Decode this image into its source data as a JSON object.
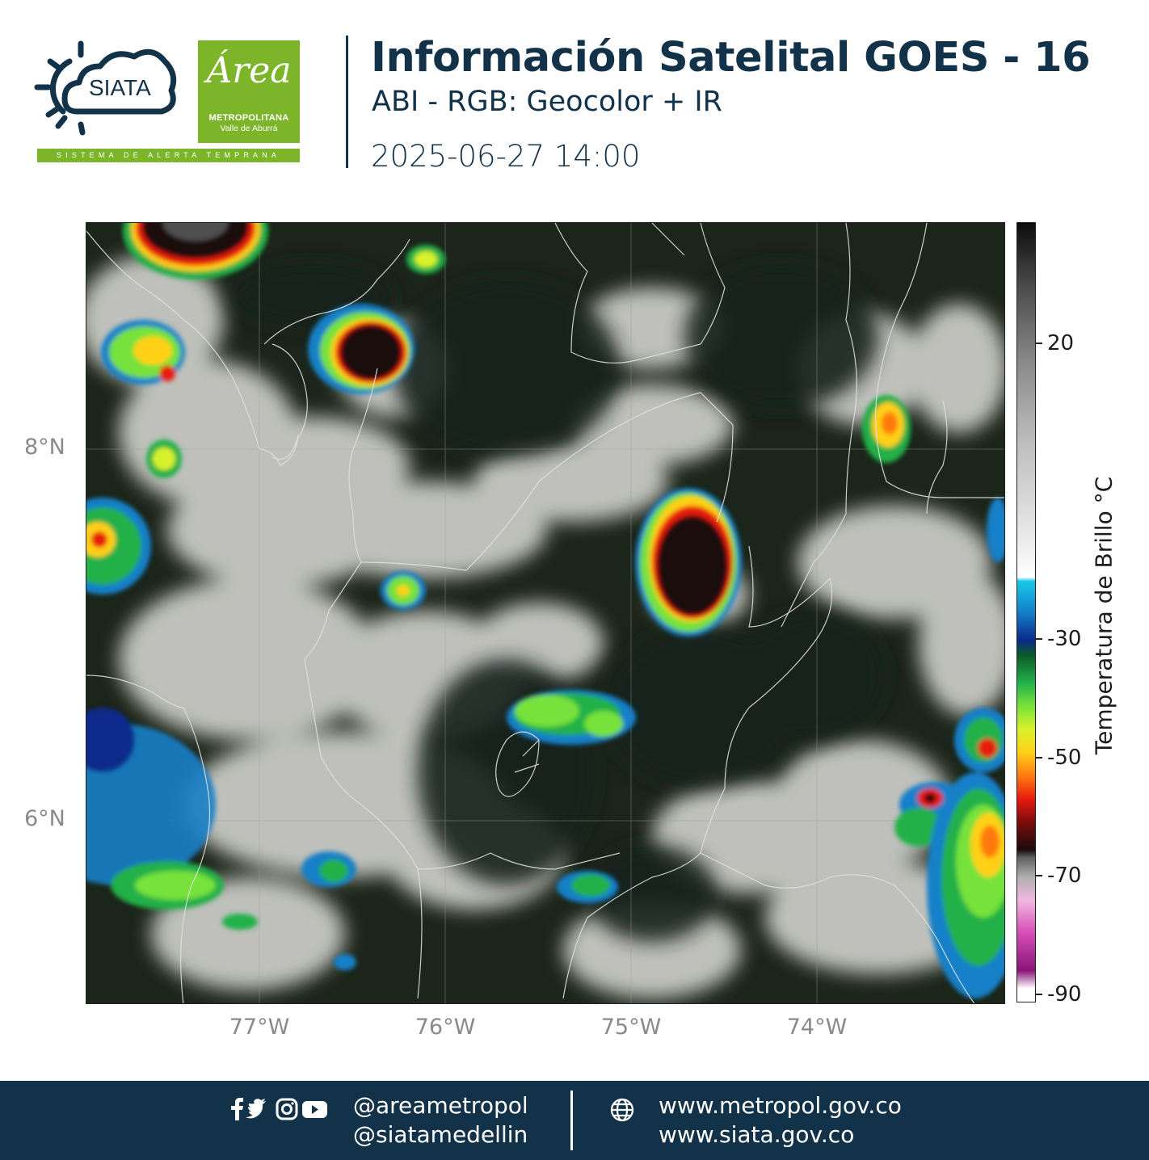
{
  "header": {
    "siata_logo_text": "SIATA",
    "area_logo_script": "Área",
    "area_logo_line1": "METROPOLITANA",
    "area_logo_line2": "Valle de Aburrá",
    "alert_system_text": "SISTEMA DE ALERTA TEMPRANA",
    "title": "Información Satelital GOES - 16",
    "subtitle": "ABI - RGB: Geocolor + IR",
    "datetime": "2025-06-27 14:00"
  },
  "map": {
    "latitude_labels": [
      "8°N",
      "6°N"
    ],
    "longitude_labels": [
      "77°W",
      "76°W",
      "75°W",
      "74°W"
    ],
    "colors": {
      "land": "#1b2418",
      "cloud": "#e6e6e6",
      "gridline": "#9a9a9a",
      "border": "#d8d8d8"
    }
  },
  "colorbar": {
    "title": "Temperatura de Brillo °C",
    "tick_labels": [
      "20",
      "-30",
      "-50",
      "-70",
      "-90"
    ]
  },
  "footer": {
    "social_icons": [
      "facebook-icon",
      "twitter-icon",
      "instagram-icon",
      "youtube-icon"
    ],
    "handles": [
      "@areametropol",
      "@siatamedellin"
    ],
    "urls": [
      "www.metropol.gov.co",
      "www.siata.gov.co"
    ],
    "background_color": "#12324a"
  }
}
